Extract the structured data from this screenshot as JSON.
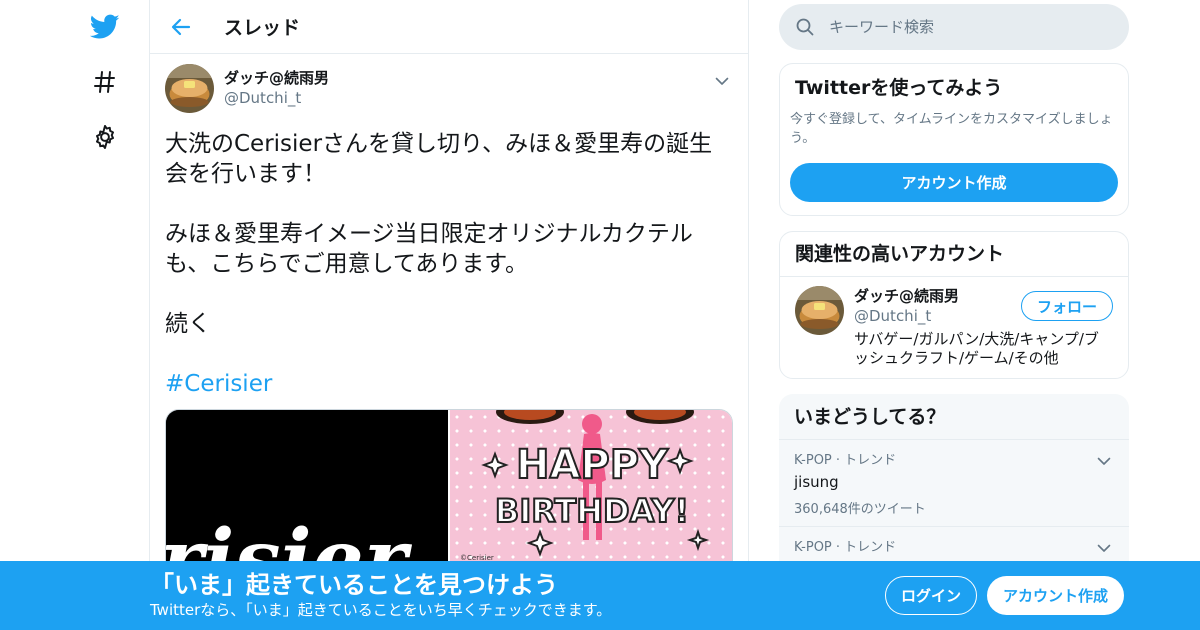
{
  "colors": {
    "accent": "#1da1f2",
    "text": "#14171a",
    "muted": "#657786",
    "border": "#e6ecf0"
  },
  "nav": {
    "icons": [
      "twitter-bird-icon",
      "hashtag-icon",
      "gear-icon"
    ]
  },
  "header": {
    "title": "スレッド"
  },
  "tweet": {
    "author_name": "ダッチ@続雨男",
    "author_handle": "@Dutchi_t",
    "lines": [
      "大洗のCerisierさんを貸し切り、みほ＆愛里寿の誕生",
      "会を行います！",
      "",
      "みほ＆愛里寿イメージ当日限定オリジナルカクテル",
      "も、こちらでご用意してあります。",
      "",
      "続く",
      ""
    ],
    "hashtag": "#Cerisier",
    "media": {
      "left_text": "risier",
      "right_text_1": "HAPPY",
      "right_text_2": "BIRTHDAY!",
      "right_credit": "©Cerisier"
    }
  },
  "search": {
    "placeholder": "キーワード検索"
  },
  "signup_card": {
    "title": "Twitterを使ってみよう",
    "subtitle": "今すぐ登録して、タイムラインをカスタマイズしましょう。",
    "button": "アカウント作成"
  },
  "related_card": {
    "title": "関連性の高いアカウント",
    "user_name": "ダッチ@続雨男",
    "user_handle": "@Dutchi_t",
    "bio": "サバゲー/ガルパン/大洗/キャンプ/ブッシュクラフト/ゲーム/その他",
    "follow_label": "フォロー"
  },
  "trends_card": {
    "title": "いまどうしてる？",
    "items": [
      {
        "meta": "K-POP · トレンド",
        "name": "jisung",
        "count": "360,648件のツイート"
      },
      {
        "meta": "K-POP · トレンド",
        "name": "",
        "count": ""
      }
    ]
  },
  "bottom_bar": {
    "title": "「いま」起きていることを見つけよう",
    "subtitle": "Twitterなら、「いま」起きていることをいち早くチェックできます。",
    "login": "ログイン",
    "signup": "アカウント作成"
  }
}
